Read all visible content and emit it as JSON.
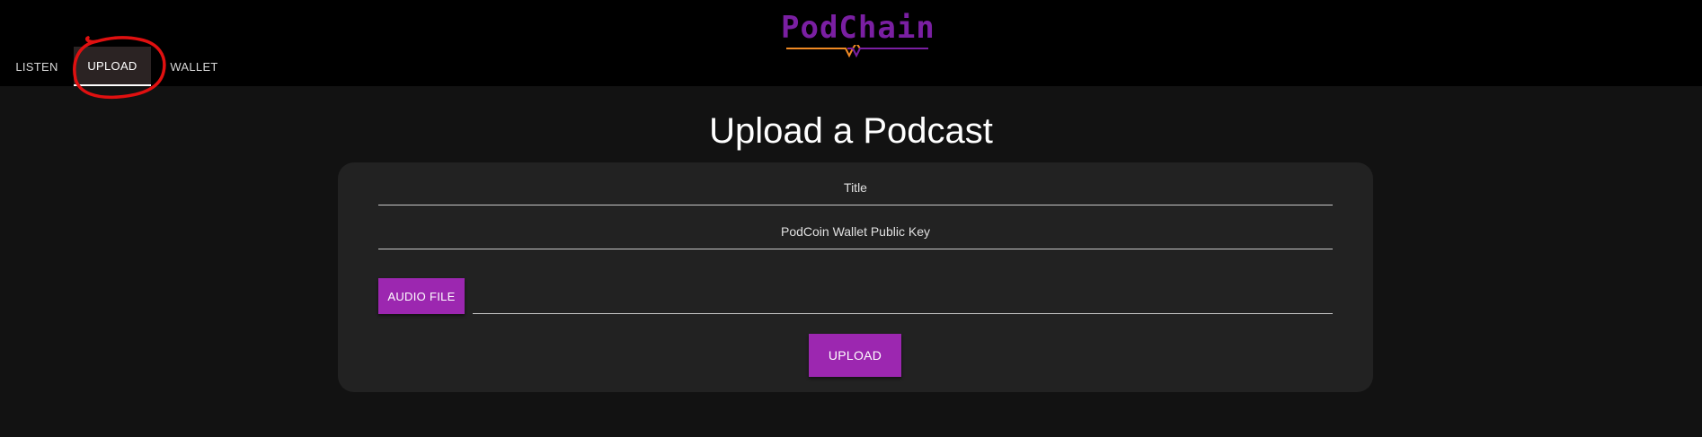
{
  "brand": {
    "name": "PodChain",
    "color": "#7a1fa2",
    "wave_colors": [
      "#f08a24",
      "#7a1fa2"
    ]
  },
  "nav": {
    "tabs": [
      {
        "label": "LISTEN",
        "active": false
      },
      {
        "label": "UPLOAD",
        "active": true
      },
      {
        "label": "WALLET",
        "active": false
      }
    ]
  },
  "annotation": {
    "color": "#e01010",
    "target": "UPLOAD tab"
  },
  "page": {
    "title": "Upload a Podcast"
  },
  "form": {
    "title_placeholder": "Title",
    "wallet_placeholder": "PodCoin Wallet Public Key",
    "audio_file_label": "AUDIO FILE",
    "submit_label": "UPLOAD"
  },
  "colors": {
    "accent": "#9c27b0",
    "background": "#121212",
    "card": "#222222",
    "topbar": "#000000"
  }
}
